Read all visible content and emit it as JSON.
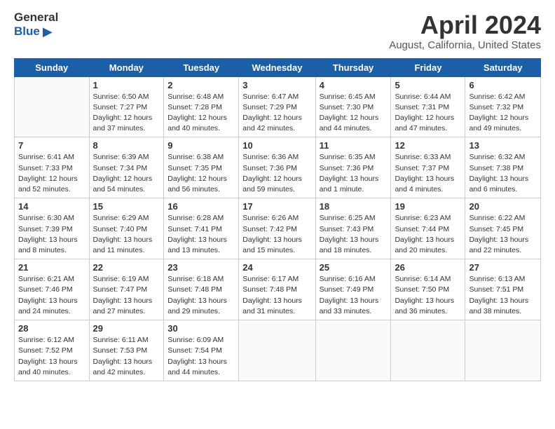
{
  "logo": {
    "general": "General",
    "blue": "Blue"
  },
  "title": "April 2024",
  "subtitle": "August, California, United States",
  "days_of_week": [
    "Sunday",
    "Monday",
    "Tuesday",
    "Wednesday",
    "Thursday",
    "Friday",
    "Saturday"
  ],
  "weeks": [
    [
      {
        "day": "",
        "detail": ""
      },
      {
        "day": "1",
        "detail": "Sunrise: 6:50 AM\nSunset: 7:27 PM\nDaylight: 12 hours\nand 37 minutes."
      },
      {
        "day": "2",
        "detail": "Sunrise: 6:48 AM\nSunset: 7:28 PM\nDaylight: 12 hours\nand 40 minutes."
      },
      {
        "day": "3",
        "detail": "Sunrise: 6:47 AM\nSunset: 7:29 PM\nDaylight: 12 hours\nand 42 minutes."
      },
      {
        "day": "4",
        "detail": "Sunrise: 6:45 AM\nSunset: 7:30 PM\nDaylight: 12 hours\nand 44 minutes."
      },
      {
        "day": "5",
        "detail": "Sunrise: 6:44 AM\nSunset: 7:31 PM\nDaylight: 12 hours\nand 47 minutes."
      },
      {
        "day": "6",
        "detail": "Sunrise: 6:42 AM\nSunset: 7:32 PM\nDaylight: 12 hours\nand 49 minutes."
      }
    ],
    [
      {
        "day": "7",
        "detail": "Sunrise: 6:41 AM\nSunset: 7:33 PM\nDaylight: 12 hours\nand 52 minutes."
      },
      {
        "day": "8",
        "detail": "Sunrise: 6:39 AM\nSunset: 7:34 PM\nDaylight: 12 hours\nand 54 minutes."
      },
      {
        "day": "9",
        "detail": "Sunrise: 6:38 AM\nSunset: 7:35 PM\nDaylight: 12 hours\nand 56 minutes."
      },
      {
        "day": "10",
        "detail": "Sunrise: 6:36 AM\nSunset: 7:36 PM\nDaylight: 12 hours\nand 59 minutes."
      },
      {
        "day": "11",
        "detail": "Sunrise: 6:35 AM\nSunset: 7:36 PM\nDaylight: 13 hours\nand 1 minute."
      },
      {
        "day": "12",
        "detail": "Sunrise: 6:33 AM\nSunset: 7:37 PM\nDaylight: 13 hours\nand 4 minutes."
      },
      {
        "day": "13",
        "detail": "Sunrise: 6:32 AM\nSunset: 7:38 PM\nDaylight: 13 hours\nand 6 minutes."
      }
    ],
    [
      {
        "day": "14",
        "detail": "Sunrise: 6:30 AM\nSunset: 7:39 PM\nDaylight: 13 hours\nand 8 minutes."
      },
      {
        "day": "15",
        "detail": "Sunrise: 6:29 AM\nSunset: 7:40 PM\nDaylight: 13 hours\nand 11 minutes."
      },
      {
        "day": "16",
        "detail": "Sunrise: 6:28 AM\nSunset: 7:41 PM\nDaylight: 13 hours\nand 13 minutes."
      },
      {
        "day": "17",
        "detail": "Sunrise: 6:26 AM\nSunset: 7:42 PM\nDaylight: 13 hours\nand 15 minutes."
      },
      {
        "day": "18",
        "detail": "Sunrise: 6:25 AM\nSunset: 7:43 PM\nDaylight: 13 hours\nand 18 minutes."
      },
      {
        "day": "19",
        "detail": "Sunrise: 6:23 AM\nSunset: 7:44 PM\nDaylight: 13 hours\nand 20 minutes."
      },
      {
        "day": "20",
        "detail": "Sunrise: 6:22 AM\nSunset: 7:45 PM\nDaylight: 13 hours\nand 22 minutes."
      }
    ],
    [
      {
        "day": "21",
        "detail": "Sunrise: 6:21 AM\nSunset: 7:46 PM\nDaylight: 13 hours\nand 24 minutes."
      },
      {
        "day": "22",
        "detail": "Sunrise: 6:19 AM\nSunset: 7:47 PM\nDaylight: 13 hours\nand 27 minutes."
      },
      {
        "day": "23",
        "detail": "Sunrise: 6:18 AM\nSunset: 7:48 PM\nDaylight: 13 hours\nand 29 minutes."
      },
      {
        "day": "24",
        "detail": "Sunrise: 6:17 AM\nSunset: 7:48 PM\nDaylight: 13 hours\nand 31 minutes."
      },
      {
        "day": "25",
        "detail": "Sunrise: 6:16 AM\nSunset: 7:49 PM\nDaylight: 13 hours\nand 33 minutes."
      },
      {
        "day": "26",
        "detail": "Sunrise: 6:14 AM\nSunset: 7:50 PM\nDaylight: 13 hours\nand 36 minutes."
      },
      {
        "day": "27",
        "detail": "Sunrise: 6:13 AM\nSunset: 7:51 PM\nDaylight: 13 hours\nand 38 minutes."
      }
    ],
    [
      {
        "day": "28",
        "detail": "Sunrise: 6:12 AM\nSunset: 7:52 PM\nDaylight: 13 hours\nand 40 minutes."
      },
      {
        "day": "29",
        "detail": "Sunrise: 6:11 AM\nSunset: 7:53 PM\nDaylight: 13 hours\nand 42 minutes."
      },
      {
        "day": "30",
        "detail": "Sunrise: 6:09 AM\nSunset: 7:54 PM\nDaylight: 13 hours\nand 44 minutes."
      },
      {
        "day": "",
        "detail": ""
      },
      {
        "day": "",
        "detail": ""
      },
      {
        "day": "",
        "detail": ""
      },
      {
        "day": "",
        "detail": ""
      }
    ]
  ]
}
